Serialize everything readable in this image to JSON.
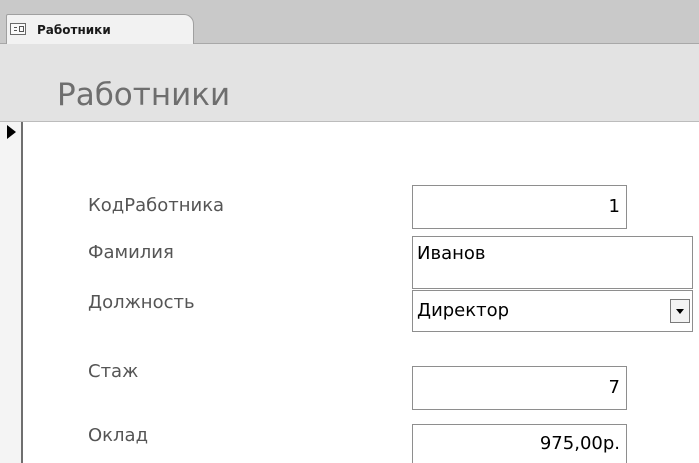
{
  "tab": {
    "label": "Работники",
    "icon": "form-icon"
  },
  "form": {
    "title": "Работники"
  },
  "fields": {
    "id": {
      "label": "КодРаботника",
      "value": "1"
    },
    "surname": {
      "label": "Фамилия",
      "value": "Иванов"
    },
    "position": {
      "label": "Должность",
      "value": "Директор"
    },
    "experience": {
      "label": "Стаж",
      "value": "7"
    },
    "salary": {
      "label": "Оклад",
      "value": "975,00р."
    }
  }
}
